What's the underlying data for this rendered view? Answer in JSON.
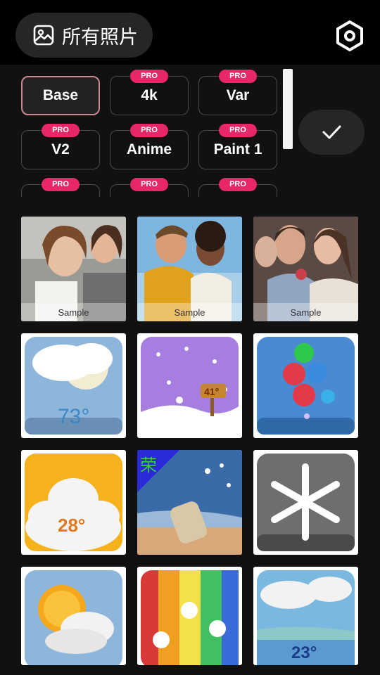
{
  "header": {
    "album_label": "所有照片",
    "album_icon": "image-icon",
    "settings_icon": "hexagon-settings-icon"
  },
  "styles": {
    "items": [
      {
        "label": "Base",
        "pro": false,
        "selected": true
      },
      {
        "label": "4k",
        "pro": true
      },
      {
        "label": "Var",
        "pro": true
      },
      {
        "label": "V2",
        "pro": true
      },
      {
        "label": "Anime",
        "pro": true
      },
      {
        "label": "Paint 1",
        "pro": true
      },
      {
        "label": "",
        "pro": true
      },
      {
        "label": "",
        "pro": true
      },
      {
        "label": "",
        "pro": true
      }
    ],
    "pro_badge": "PRO",
    "confirm_icon": "check-icon"
  },
  "photos": {
    "sample_label": "Sample",
    "weather_73": "73°",
    "sign_41": "41°",
    "weather_28": "28°",
    "stamp_text": "荣",
    "weather_23": "23°"
  },
  "colors": {
    "accent_pro": "#e8276b",
    "selected_border": "#c98a90"
  }
}
